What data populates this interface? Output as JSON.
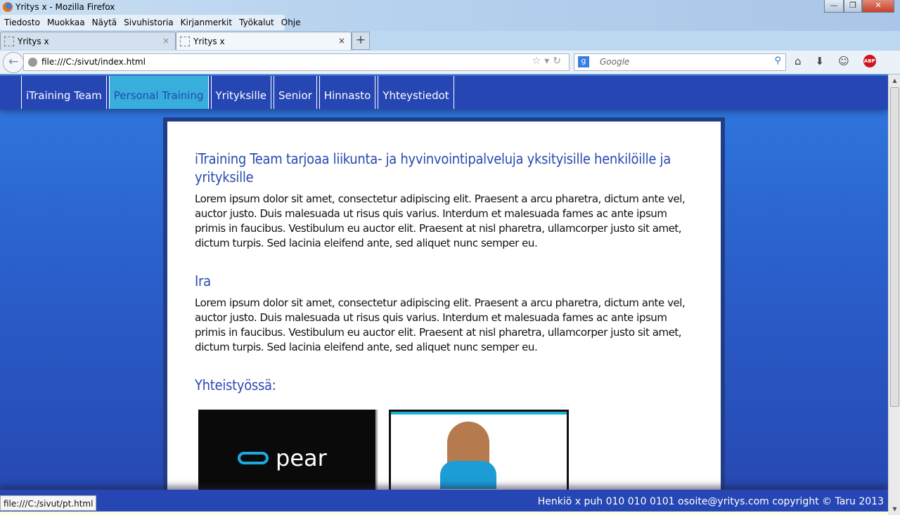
{
  "window": {
    "title": "Yritys x - Mozilla Firefox",
    "minimize": "—",
    "restore": "❐",
    "close": "✕"
  },
  "menu": [
    "Tiedosto",
    "Muokkaa",
    "Näytä",
    "Sivuhistoria",
    "Kirjanmerkit",
    "Työkalut",
    "Ohje"
  ],
  "tabs": [
    {
      "label": "Yritys x",
      "close": "×"
    },
    {
      "label": "Yritys x",
      "close": "×"
    }
  ],
  "new_tab": "+",
  "url": "file:///C:/sivut/index.html",
  "search": {
    "placeholder": "Google",
    "engine": "g"
  },
  "abp": "ABP",
  "site_nav": [
    "iTraining Team",
    "Personal Training",
    "Yrityksille",
    "Senior",
    "Hinnasto",
    "Yhteystiedot"
  ],
  "site_nav_active": "Personal Training",
  "content": {
    "heading1": "iTraining Team tarjoaa liikunta- ja hyvinvointipalveluja yksityisille henkilöille ja yrityksille",
    "para1": "Lorem ipsum dolor sit amet, consectetur adipiscing elit. Praesent a arcu pharetra, dictum ante vel, auctor justo. Duis malesuada ut risus quis varius. Interdum et malesuada fames ac ante ipsum primis in faucibus. Vestibulum eu auctor elit. Praesent at nisl pharetra, ullamcorper justo sit amet, dictum turpis. Sed lacinia eleifend ante, sed aliquet nunc semper eu.",
    "heading2": "Ira",
    "para2": "Lorem ipsum dolor sit amet, consectetur adipiscing elit. Praesent a arcu pharetra, dictum ante vel, auctor justo. Duis malesuada ut risus quis varius. Interdum et malesuada fames ac ante ipsum primis in faucibus. Vestibulum eu auctor elit. Praesent at nisl pharetra, ullamcorper justo sit amet, dictum turpis. Sed lacinia eleifend ante, sed aliquet nunc semper eu.",
    "heading3": "Yhteistyössä:",
    "partner1": "pear"
  },
  "footer": "Henkiö x puh 010 010 0101 osoite@yritys.com copyright © Taru 2013",
  "status_url": "file:///C:/sivut/pt.html",
  "colors": {
    "nav": "#2646b3",
    "active_nav": "#38aedc",
    "heading": "#2a4ab0"
  }
}
